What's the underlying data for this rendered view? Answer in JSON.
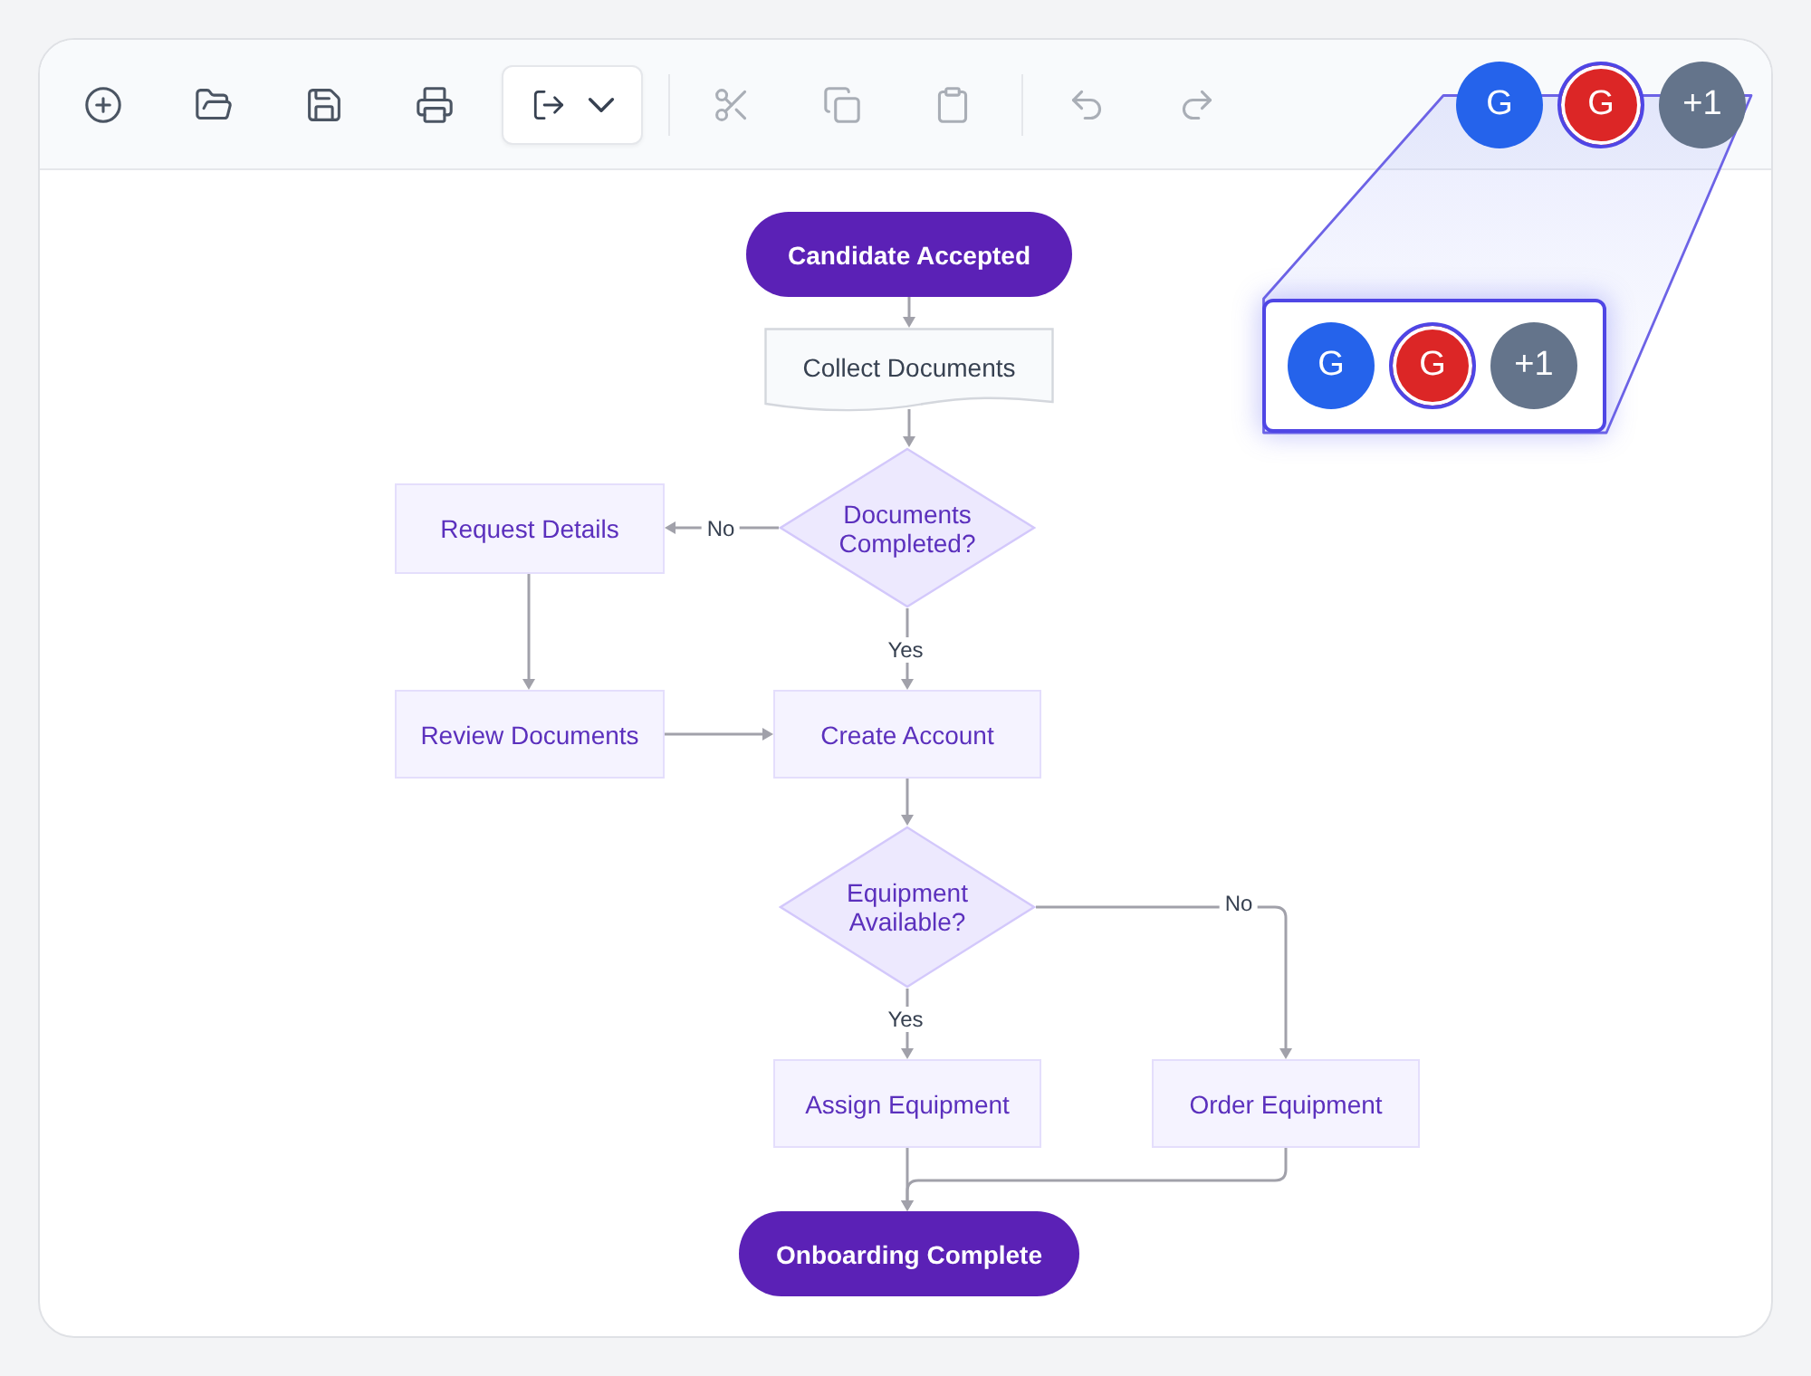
{
  "toolbar": {
    "file_actions": [
      {
        "kind": "new",
        "disabled": false
      },
      {
        "kind": "open",
        "disabled": false
      },
      {
        "kind": "save",
        "disabled": false
      },
      {
        "kind": "print",
        "disabled": false
      },
      {
        "kind": "export",
        "disabled": false
      }
    ],
    "edit_actions": [
      {
        "kind": "cut",
        "disabled": true
      },
      {
        "kind": "copy",
        "disabled": true
      },
      {
        "kind": "paste",
        "disabled": true
      }
    ],
    "history_actions": [
      {
        "kind": "undo",
        "disabled": true
      },
      {
        "kind": "redo",
        "disabled": true
      }
    ],
    "avatars": [
      {
        "label": "G",
        "color": "#2563eb",
        "selected": false
      },
      {
        "label": "G",
        "color": "#dc2626",
        "selected": true
      },
      {
        "label": "+1",
        "color": "#64748b",
        "selected": false
      }
    ]
  },
  "magnifier": {
    "avatars": [
      {
        "label": "G",
        "color": "#2563eb",
        "selected": false
      },
      {
        "label": "G",
        "color": "#dc2626",
        "selected": true
      },
      {
        "label": "+1",
        "color": "#64748b",
        "selected": false
      }
    ]
  },
  "flowchart": {
    "nodes": [
      {
        "kind": "terminal",
        "label": "Candidate Accepted"
      },
      {
        "kind": "document",
        "label": "Collect Documents"
      },
      {
        "kind": "process",
        "label": "Request Details"
      },
      {
        "kind": "decision",
        "label": "Documents Completed?",
        "branches": [
          {
            "label": "No"
          },
          {
            "label": "Yes"
          }
        ]
      },
      {
        "kind": "process",
        "label": "Review Documents"
      },
      {
        "kind": "process",
        "label": "Create Account"
      },
      {
        "kind": "decision",
        "label": "Equipment Available?",
        "branches": [
          {
            "label": "No"
          },
          {
            "label": "Yes"
          }
        ]
      },
      {
        "kind": "process",
        "label": "Assign Equipment"
      },
      {
        "kind": "process",
        "label": "Order Equipment"
      },
      {
        "kind": "terminal",
        "label": "Onboarding Complete"
      }
    ]
  }
}
